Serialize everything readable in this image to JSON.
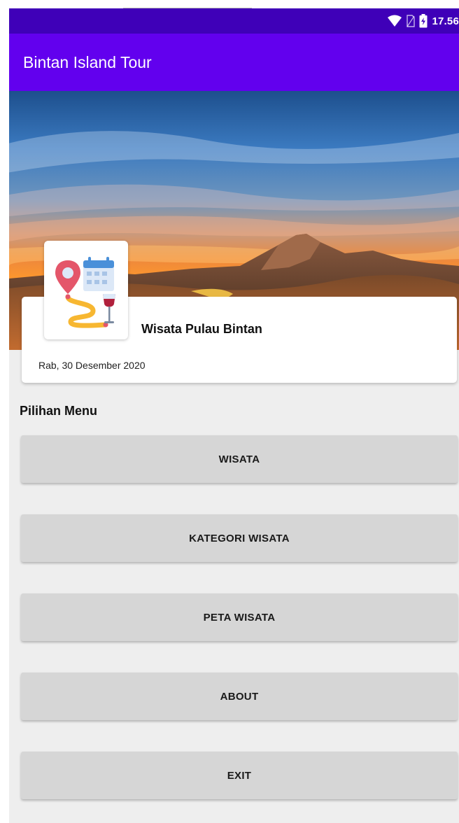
{
  "status_bar": {
    "time": "17.56",
    "icons": [
      "wifi-icon",
      "no-sim-icon",
      "battery-charging-icon"
    ]
  },
  "app_bar": {
    "title": "Bintan Island Tour"
  },
  "hero": {
    "image": "sunset-volcano-landscape"
  },
  "info_card": {
    "logo": "travel-route-icon",
    "title": "Wisata Pulau Bintan",
    "date": "Rab, 30 Desember 2020"
  },
  "menu": {
    "section_label": "Pilihan Menu",
    "buttons": [
      {
        "label": "WISATA"
      },
      {
        "label": "KATEGORI WISATA"
      },
      {
        "label": "PETA WISATA"
      },
      {
        "label": "ABOUT"
      },
      {
        "label": "EXIT"
      }
    ]
  },
  "colors": {
    "status_bar": "#3f00b8",
    "app_bar": "#6200ee",
    "background": "#eeeeee",
    "button": "#d6d6d6"
  }
}
